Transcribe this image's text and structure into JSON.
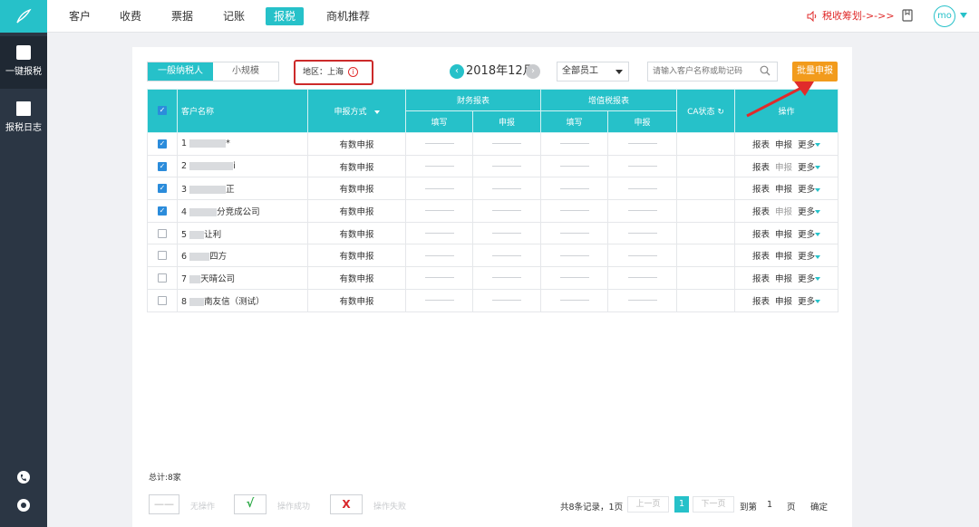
{
  "sidebar": {
    "items": [
      {
        "label": "一键报税",
        "active": true
      },
      {
        "label": "报税日志",
        "active": false
      }
    ]
  },
  "nav": {
    "items": [
      "客户",
      "收费",
      "票据",
      "记账",
      "报税",
      "商机推荐"
    ],
    "active": "报税",
    "promo": "税收筹划->->>",
    "avatar": "mo"
  },
  "toolbar": {
    "tabs": [
      "一般纳税人",
      "小规模"
    ],
    "active_tab": "一般纳税人",
    "region": "地区：上海",
    "period": "2018年12月",
    "staff": "全部员工",
    "search_placeholder": "请输入客户名称或助记码",
    "batch_button": "批量申报"
  },
  "table": {
    "headers": {
      "name": "客户名称",
      "method": "申报方式",
      "finance": "财务报表",
      "vat": "增值税报表",
      "fill": "填写",
      "declare": "申报",
      "ca": "CA状态",
      "ops": "操作"
    },
    "rows": [
      {
        "no": "1",
        "name": "*",
        "method": "有数申报",
        "checked": true,
        "op_declare_disabled": false
      },
      {
        "no": "2",
        "name": "i",
        "method": "有数申报",
        "checked": true,
        "op_declare_disabled": true
      },
      {
        "no": "3",
        "name": "正",
        "method": "有数申报",
        "checked": true,
        "op_declare_disabled": false
      },
      {
        "no": "4",
        "name": "分竞成公司",
        "method": "有数申报",
        "checked": true,
        "op_declare_disabled": true
      },
      {
        "no": "5",
        "name": "让利",
        "method": "有数申报",
        "checked": false,
        "op_declare_disabled": false
      },
      {
        "no": "6",
        "name": "四方",
        "method": "有数申报",
        "checked": false,
        "op_declare_disabled": false
      },
      {
        "no": "7",
        "name": "天晴公司",
        "method": "有数申报",
        "checked": false,
        "op_declare_disabled": false
      },
      {
        "no": "8",
        "name": "南友信（测试）",
        "method": "有数申报",
        "checked": false,
        "op_declare_disabled": false
      }
    ],
    "op_labels": {
      "report": "报表",
      "declare": "申报",
      "more": "更多"
    }
  },
  "footer": {
    "total": "总计:8家",
    "legend": [
      {
        "symbol": "——",
        "label": "无操作"
      },
      {
        "symbol": "√",
        "label": "操作成功"
      },
      {
        "symbol": "X",
        "label": "操作失败"
      }
    ],
    "records": "共8条记录，1页",
    "prev": "上一页",
    "page": "1",
    "next": "下一页",
    "goto": "到第",
    "goto_value": "1",
    "page_unit": "页",
    "confirm": "确定"
  },
  "colors": {
    "accent": "#26c1c9",
    "batch": "#f29b1c",
    "alert": "#cc2a2a",
    "sidebar": "#2b3644"
  }
}
